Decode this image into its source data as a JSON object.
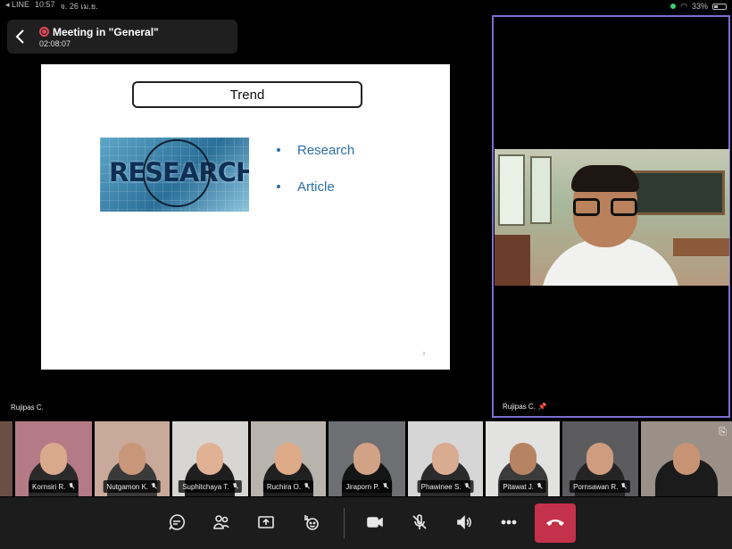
{
  "status_bar": {
    "app": "◂ LINE",
    "time": "10:57",
    "date": "จ. 26 เม.ย.",
    "battery": "33%"
  },
  "meeting": {
    "title": "Meeting in \"General\"",
    "elapsed": "02:08:07"
  },
  "slide": {
    "title": "Trend",
    "image_text": "RESEARCH",
    "bullets": [
      "Research",
      "Article"
    ],
    "page_number": "3"
  },
  "shared_by": "Rujipas C.",
  "speaker": {
    "name": "Rujipas C."
  },
  "participants": [
    {
      "name": "Kornsiri R."
    },
    {
      "name": "Nutgamon K."
    },
    {
      "name": "Suphitchaya T."
    },
    {
      "name": "Ruchira O."
    },
    {
      "name": "Jiraporn P."
    },
    {
      "name": "Phawinee S."
    },
    {
      "name": "Pitawat J."
    },
    {
      "name": "Pornsawan R."
    }
  ],
  "toolbar": {
    "chat_icon": "chat-icon",
    "people_icon": "people-icon",
    "share_icon": "share-icon",
    "reactions_icon": "reactions-icon",
    "camera_icon": "camera-icon",
    "mic_icon": "mic-off-icon",
    "speaker_icon": "speaker-icon",
    "more_icon": "more-icon",
    "hangup_icon": "hangup-icon"
  },
  "colors": {
    "accent": "#7b6fd0",
    "hangup": "#c4314b",
    "slide_text": "#2d6fa3"
  }
}
